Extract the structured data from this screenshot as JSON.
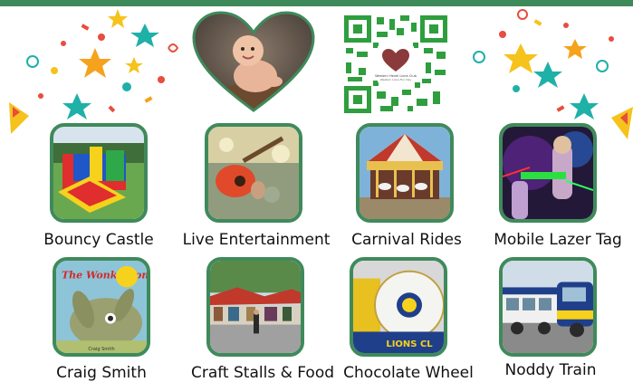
{
  "colors": {
    "frame": "#3f8a5b",
    "top_bar": "#3f8a5b",
    "text": "#111111"
  },
  "qr": {
    "caption_lines": [
      "Western Hevel Lions Club",
      "Western Lions Fun Day"
    ]
  },
  "activities": [
    {
      "label": "Bouncy Castle",
      "image": "bouncy-castle-photo"
    },
    {
      "label": "Live Entertainment",
      "image": "guitarist-photo"
    },
    {
      "label": "Carnival Rides",
      "image": "carousel-photo"
    },
    {
      "label": "Mobile Lazer Tag",
      "image": "lazer-tag-photo"
    },
    {
      "label": "Craig Smith",
      "image": "wonky-donkey-book-cover",
      "book_title": "The Wonky Donkey",
      "book_author": "Craig Smith"
    },
    {
      "label": "Craft Stalls & Food",
      "image": "market-stalls-photo"
    },
    {
      "label": "Chocolate Wheel",
      "image": "lions-club-wheel-photo",
      "wheel_text": "LIONS CL"
    },
    {
      "label": "Noddy Train",
      "image": "road-train-photo"
    }
  ]
}
